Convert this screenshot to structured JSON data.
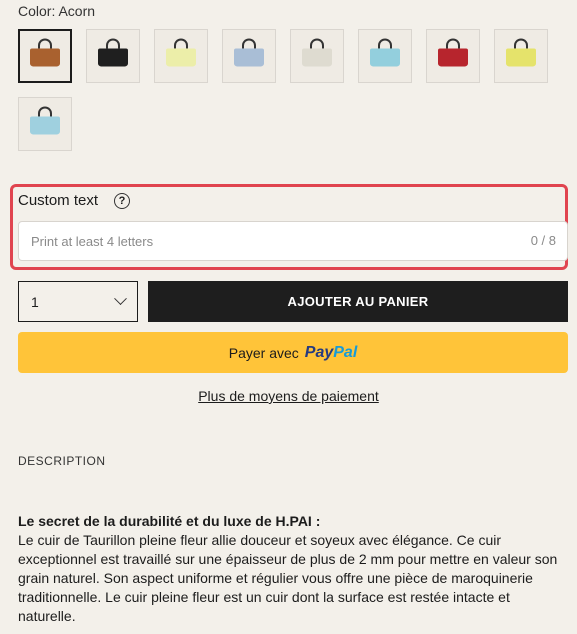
{
  "color": {
    "label": "Color: Acorn"
  },
  "swatches": [
    {
      "name": "Acorn",
      "bag_color": "#a9612f",
      "selected": true
    },
    {
      "name": "Black",
      "bag_color": "#1f1f1f"
    },
    {
      "name": "Butter",
      "bag_color": "#eceea9"
    },
    {
      "name": "Sky Blue",
      "bag_color": "#a9bed6"
    },
    {
      "name": "Cream",
      "bag_color": "#dedbd0"
    },
    {
      "name": "Aqua",
      "bag_color": "#93cfdd"
    },
    {
      "name": "Red",
      "bag_color": "#b7252d"
    },
    {
      "name": "Lemon",
      "bag_color": "#e5e36b"
    },
    {
      "name": "Light Blue",
      "bag_color": "#9fd0df"
    }
  ],
  "custom": {
    "label": "Custom text",
    "help": "?",
    "placeholder": "Print at least 4 letters",
    "count": "0 / 8"
  },
  "quantity": {
    "value": "1"
  },
  "buttons": {
    "add_to_cart": "AJOUTER AU PANIER",
    "paypal_prefix": "Payer avec",
    "paypal_brand_1": "Pay",
    "paypal_brand_2": "Pal",
    "more_payment": "Plus de moyens de paiement"
  },
  "description": {
    "title": "DESCRIPTION",
    "heading": "Le secret de la durabilité et du luxe de H.PAI :",
    "body": "Le cuir de Taurillon pleine fleur allie douceur et soyeux avec élégance. Ce cuir exceptionnel est travaillé sur une épaisseur de plus de 2 mm pour mettre en valeur son grain naturel. Son aspect uniforme et régulier vous offre une pièce de maroquinerie traditionnelle. Le cuir pleine fleur est un cuir dont la surface est restée intacte et naturelle."
  },
  "colors": {
    "highlight": "#e0444f",
    "paypal_yellow": "#ffc439",
    "cart_black": "#1e1e1e"
  }
}
